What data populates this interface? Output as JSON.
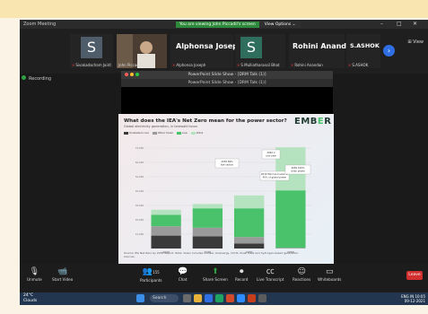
{
  "window": {
    "title": "Zoom Meeting",
    "share_message": "You are viewing John Piccadil's screen",
    "view_options": "View Options ⌄",
    "view_button": "⊞ View"
  },
  "participants": [
    {
      "initial": "S",
      "name": "Sivakadacham Jairit",
      "has_video": false
    },
    {
      "initial": "",
      "name": "John Piccadil",
      "has_video": true
    },
    {
      "big_name": "Alphonsa Joseph",
      "name": "Alphonsa Joseph",
      "has_video": false
    },
    {
      "initial": "S",
      "name": "S Mulliatharassil Bhat",
      "has_video": false
    },
    {
      "big_name": "Rohini Anandan",
      "name": "Rohini Anandan",
      "has_video": false
    },
    {
      "big_name": "S.ASHOK",
      "name": "S.ASHOK",
      "has_video": false
    }
  ],
  "recording_label": "Recording",
  "presentation": {
    "window_title": "PowerPoint Slide Show - [DRM Talk (1)]",
    "inner_title": "PowerPoint Slide Show - [DRM Talk (1)]"
  },
  "slide": {
    "title": "What does the IEA's Net Zero mean for the power sector?",
    "subtitle": "Global electricity generation, in terawatt hours",
    "logo_left": "EMB",
    "logo_mid": "E",
    "logo_right": "R",
    "legend": [
      {
        "label": "Unabated coal",
        "color": "#3a3a3a"
      },
      {
        "label": "Other fossil",
        "color": "#9a9a9a"
      },
      {
        "label": "Low",
        "color": "#49c26b"
      },
      {
        "label": "Wind",
        "color": "#b6e3bf"
      }
    ],
    "source_text": "Source: IEA Net Zero by 2050 Report. Note: Clean includes nuclear, bioenergy, CCUS, fossil fuels and hydrogen-based generation sources."
  },
  "chart_data": {
    "type": "bar",
    "stacked": true,
    "categories": [
      "2020",
      "2025",
      "2030",
      "2050"
    ],
    "series": [
      {
        "name": "Unabated coal",
        "values": [
          9000,
          8500,
          3500,
          0
        ],
        "color": "#3a3a3a"
      },
      {
        "name": "Other fossil",
        "values": [
          6500,
          6000,
          4500,
          500
        ],
        "color": "#9a9a9a"
      },
      {
        "name": "Low",
        "values": [
          8000,
          13500,
          20000,
          40000
        ],
        "color": "#49c26b"
      },
      {
        "name": "Wind",
        "values": [
          3500,
          3000,
          9000,
          30000
        ],
        "color": "#b6e3bf"
      }
    ],
    "ylim": [
      0,
      75000
    ],
    "yticks": [
      "10,000",
      "20,000",
      "30,000",
      "40,000",
      "50,000",
      "60,000",
      "70,000"
    ],
    "annotations": [
      "2030 69% low-carbon",
      "2030 Wind and solar at 40% of global power",
      "2040 2 coal year",
      "2050 100% clean power"
    ]
  },
  "toolbar": {
    "unmute": "Unmute",
    "start_video": "Start Video",
    "participants": "Participants",
    "participants_count": "155",
    "chat": "Chat",
    "share_screen": "Share Screen",
    "record": "Record",
    "live_transcript": "Live Transcript",
    "reactions": "Reactions",
    "whiteboards": "Whiteboards",
    "leave": "Leave"
  },
  "taskbar": {
    "weather_temp": "24°C",
    "weather_desc": "Clouds",
    "search": "Search",
    "lang": "ENG IN",
    "time": "10:05",
    "date": "09-12-2021"
  }
}
